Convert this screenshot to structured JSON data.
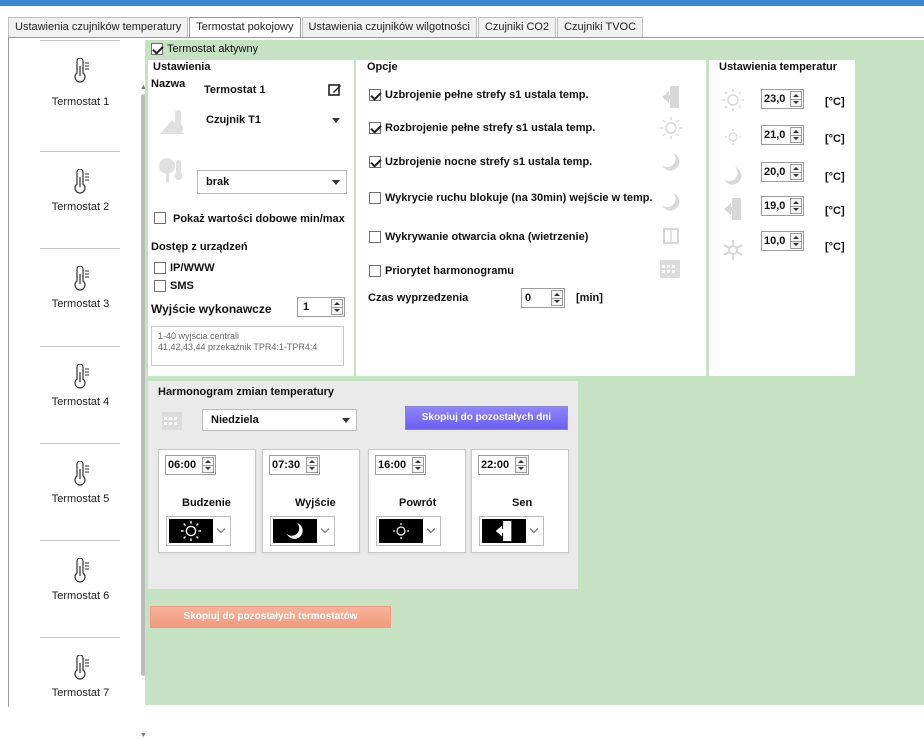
{
  "tabs": [
    "Ustawienia czujników temperatury",
    "Termostat pokojowy",
    "Ustawienia czujników wilgotności",
    "Czujniki CO2",
    "Czujniki TVOC"
  ],
  "active_tab": 1,
  "thermostats": [
    "Termostat 1",
    "Termostat 2",
    "Termostat 3",
    "Termostat 4",
    "Termostat 5",
    "Termostat 6",
    "Termostat 7"
  ],
  "active_label": "Termostat aktywny",
  "settings": {
    "legend": "Ustawienia",
    "name_label": "Nazwa",
    "name_value": "Termostat 1",
    "sensor_value": "Czujnik T1",
    "second_sensor_value": "brak",
    "show_daily_label": "Pokaż wartości dobowe min/max",
    "access_label": "Dostęp z urządzeń",
    "ipwww_label": "IP/WWW",
    "sms_label": "SMS",
    "output_label": "Wyjście wykonawcze",
    "output_value": "1",
    "hint_line1": "1-40 wyjścia centrali",
    "hint_line2": "41,42,43,44 przekaźnik TPR4:1-TPR4:4"
  },
  "options": {
    "legend": "Opcje",
    "items": [
      {
        "label": "Uzbrojenie pełne strefy s1 ustala temp.",
        "checked": true,
        "icon": "door-exit-icon"
      },
      {
        "label": "Rozbrojenie pełne strefy s1 ustala temp.",
        "checked": true,
        "icon": "sun-icon"
      },
      {
        "label": "Uzbrojenie nocne strefy s1 ustala temp.",
        "checked": true,
        "icon": "moon-icon"
      },
      {
        "label": "Wykrycie ruchu blokuje (na 30min) wejście w temp.",
        "checked": false,
        "icon": "moon-icon"
      },
      {
        "label": "Wykrywanie otwarcia okna (wietrzenie)",
        "checked": false,
        "icon": "window-icon"
      },
      {
        "label": "Priorytet harmonogramu",
        "checked": false,
        "icon": "calendar-icon"
      }
    ],
    "advance_label": "Czas wyprzedzenia",
    "advance_value": "0",
    "advance_unit": "[min]"
  },
  "temperatures": {
    "legend": "Ustawienia temperatur",
    "unit": "[°C]",
    "items": [
      {
        "icon": "sun-icon",
        "value": "23,0"
      },
      {
        "icon": "small-sun-icon",
        "value": "21,0"
      },
      {
        "icon": "moon-icon",
        "value": "20,0"
      },
      {
        "icon": "door-exit-icon",
        "value": "19,0"
      },
      {
        "icon": "snowflake-icon",
        "value": "10,0"
      }
    ]
  },
  "schedule": {
    "legend": "Harmonogram zmian temperatury",
    "day": "Niedziela",
    "copy_days_label": "Skopiuj do pozostałych dni",
    "cards": [
      {
        "time": "06:00",
        "label": "Budzenie",
        "icon": "sun-icon"
      },
      {
        "time": "07:30",
        "label": "Wyjście",
        "icon": "moon-icon"
      },
      {
        "time": "16:00",
        "label": "Powrót",
        "icon": "small-sun-icon"
      },
      {
        "time": "22:00",
        "label": "Sen",
        "icon": "door-exit-icon"
      }
    ]
  },
  "copy_thermostats_label": "Skopiuj do pozostałych termostatów",
  "colors": {
    "accent": "#3c86d4",
    "background": "#c5e3c2",
    "blue_button": "#7a70f8",
    "orange_button": "#f4a78b"
  }
}
